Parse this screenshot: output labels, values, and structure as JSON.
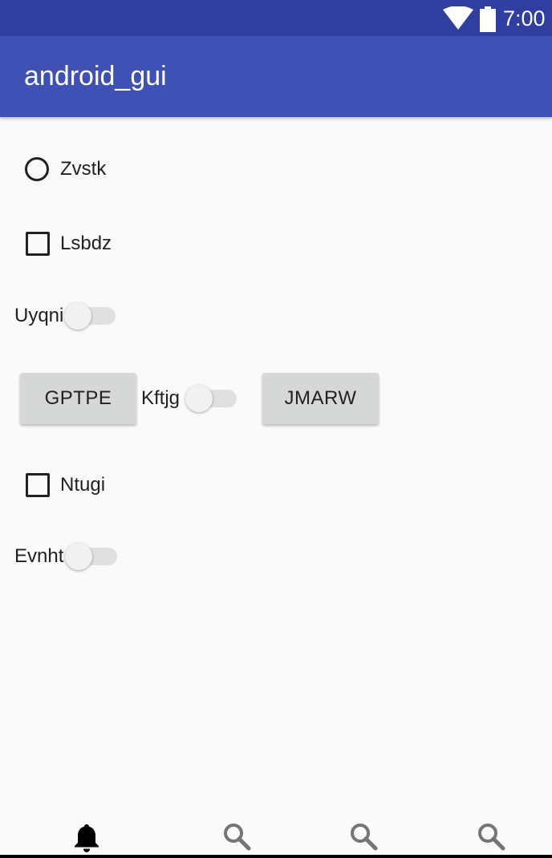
{
  "status_bar": {
    "time": "7:00",
    "icons": [
      "wifi-icon",
      "battery-icon"
    ],
    "color": "#303f9f"
  },
  "app_bar": {
    "title": "android_gui",
    "color": "#3f51b5"
  },
  "controls": {
    "radio_zvstk": {
      "label": "Zvstk",
      "checked": false
    },
    "checkbox_lsbdz": {
      "label": "Lsbdz",
      "checked": false
    },
    "switch_uyqni": {
      "label": "Uyqni",
      "on": false
    },
    "button_gptpe": {
      "label": "GPTPE"
    },
    "switch_kftjg": {
      "label": "Kftjg",
      "on": false
    },
    "button_jmarw": {
      "label": "JMARW"
    },
    "checkbox_ntugi": {
      "label": "Ntugi",
      "checked": false
    },
    "switch_evnht": {
      "label": "Evnht",
      "on": false
    }
  },
  "bottom_nav": {
    "items": [
      {
        "icon": "bell-icon",
        "selected": true
      },
      {
        "icon": "search-icon",
        "selected": false
      },
      {
        "icon": "search-icon",
        "selected": false
      },
      {
        "icon": "search-icon",
        "selected": false
      }
    ]
  }
}
